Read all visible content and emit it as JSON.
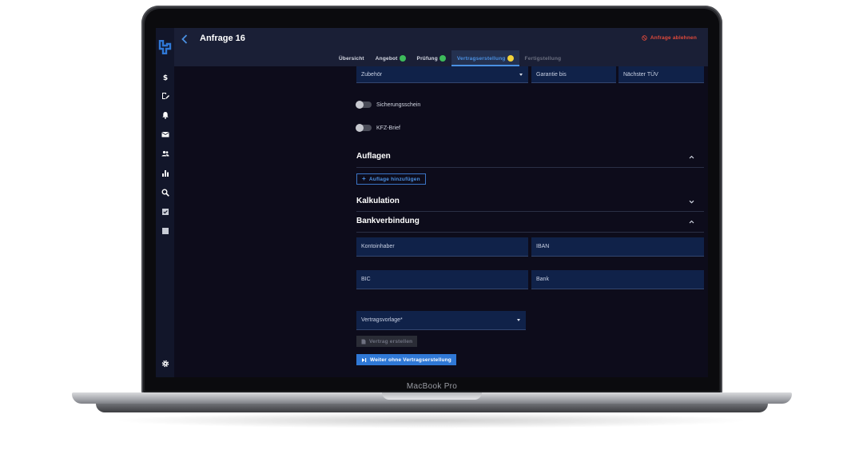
{
  "device": {
    "label": "MacBook Pro"
  },
  "app": {
    "page_title": "Anfrage 16",
    "reject_label": "Anfrage ablehnen",
    "colors": {
      "accent": "#4a90e2",
      "danger": "#e24a3b",
      "success": "#3dbb5b",
      "pending": "#f2d23a"
    }
  },
  "sidebar": {
    "items": [
      {
        "icon": "dollar-icon"
      },
      {
        "icon": "document-edit-icon"
      },
      {
        "icon": "bell-icon"
      },
      {
        "icon": "mail-icon"
      },
      {
        "icon": "people-icon"
      },
      {
        "icon": "bar-chart-icon"
      },
      {
        "icon": "search-icon"
      },
      {
        "icon": "checkbox-icon"
      },
      {
        "icon": "square-icon"
      }
    ],
    "settings_icon": "gear-icon"
  },
  "tabs": [
    {
      "label": "Übersicht",
      "state": "done"
    },
    {
      "label": "Angebot",
      "state": "check"
    },
    {
      "label": "Prüfung",
      "state": "check"
    },
    {
      "label": "Vertragserstellung",
      "state": "active"
    },
    {
      "label": "Fertigstellung",
      "state": "disabled"
    }
  ],
  "vehicle_fields": {
    "zubehoer": "Zubehör",
    "garantie": "Garantie bis",
    "tuev": "Nächster TÜV"
  },
  "toggles": [
    {
      "label": "Sicherungsschein",
      "on": false
    },
    {
      "label": "KFZ-Brief",
      "on": false
    }
  ],
  "sections": {
    "auflagen": {
      "title": "Auflagen",
      "expanded": true,
      "add_button": "Auflage hinzufügen"
    },
    "kalkulation": {
      "title": "Kalkulation",
      "expanded": false
    },
    "bankverbindung": {
      "title": "Bankverbindung",
      "expanded": true,
      "fields": {
        "kontoinhaber": "Kontoinhaber",
        "iban": "IBAN",
        "bic": "BIC",
        "bank": "Bank"
      }
    }
  },
  "contract": {
    "template_label": "Vertragsvorlage*",
    "create_button": "Vertrag erstellen",
    "continue_button": "Weiter ohne Vertragserstellung"
  }
}
